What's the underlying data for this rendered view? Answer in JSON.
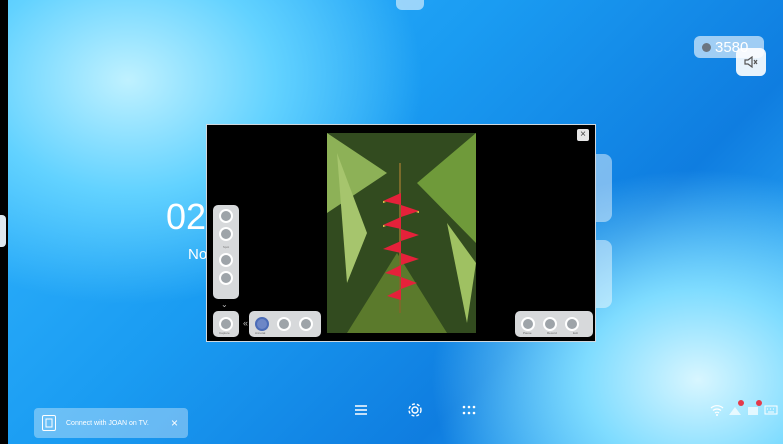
{
  "status": {
    "count": "3580"
  },
  "home": {
    "time": "02",
    "date": "Nov"
  },
  "player": {
    "close_label": "×",
    "side_panel": {
      "items": [
        "",
        "Spot",
        "",
        ""
      ]
    },
    "chevron_down": "⌄",
    "left_arrow": "«",
    "tool_left": {
      "label": "Capture"
    },
    "tool_mid": {
      "items": [
        "Annotat",
        "",
        ""
      ]
    },
    "tool_right": {
      "items": [
        "Pause",
        "Record",
        "Exit"
      ]
    }
  },
  "dock": {
    "items": [
      "menu-icon",
      "settings-icon",
      "apps-icon"
    ]
  },
  "banner": {
    "text": "Connect with JOAN on TV.",
    "icon_label": "joan",
    "close": "×"
  },
  "colors": {
    "accent": "#1a9cf2",
    "badge": "#e43a4a"
  }
}
